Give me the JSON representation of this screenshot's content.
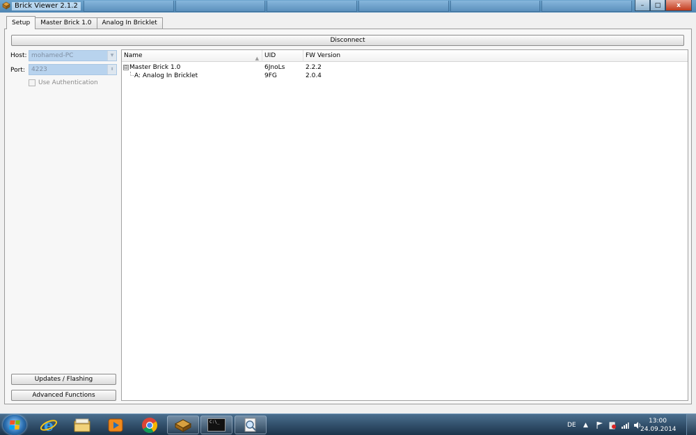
{
  "window": {
    "title": "Brick Viewer 2.1.2",
    "controls": {
      "minimize": "–",
      "maximize": "□",
      "close": "x"
    }
  },
  "tabs": [
    {
      "label": "Setup",
      "active": true
    },
    {
      "label": "Master Brick 1.0",
      "active": false
    },
    {
      "label": "Analog In Bricklet",
      "active": false
    }
  ],
  "setup": {
    "disconnect_label": "Disconnect",
    "host_label": "Host:",
    "host_value": "mohamed-PC",
    "port_label": "Port:",
    "port_value": "4223",
    "auth_label": "Use Authentication",
    "updates_label": "Updates / Flashing",
    "advanced_label": "Advanced Functions"
  },
  "tree": {
    "columns": [
      "Name",
      "UID",
      "FW Version"
    ],
    "rows": [
      {
        "name": "Master Brick 1.0",
        "uid": "6JnoLs",
        "fw": "2.2.2",
        "expander": "⊟"
      },
      {
        "name": "A: Analog In Bricklet",
        "uid": "9FG",
        "fw": "2.0.4"
      }
    ]
  },
  "taskbar": {
    "language": "DE",
    "time": "13:00",
    "date": "24.09.2014",
    "terminal_text": "C:\\_"
  },
  "colors": {
    "accent": "#b8d3ee",
    "taskbar": "#1c344b",
    "titlebar": "#4f86b3"
  }
}
